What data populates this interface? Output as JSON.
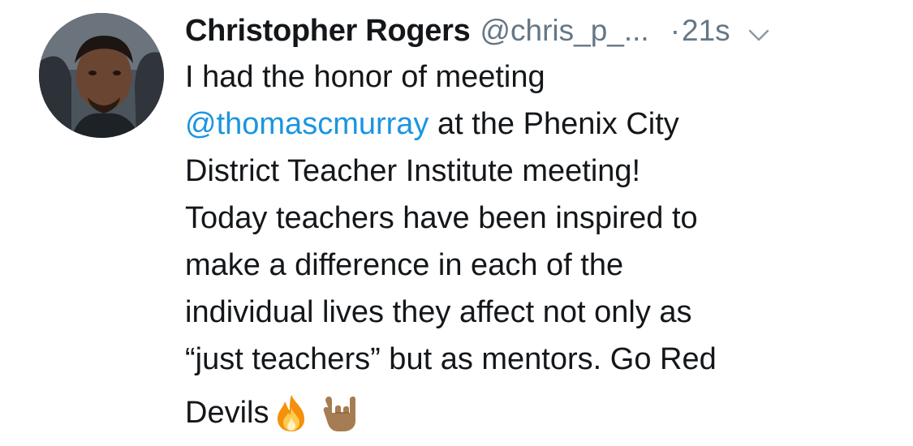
{
  "tweet": {
    "display_name": "Christopher Rogers",
    "handle": "@chris_p_...",
    "separator": "·",
    "timestamp": "21s",
    "menu_icon": "chevron-down-icon",
    "avatar_icon": "avatar",
    "body": {
      "line1": "I had the honor of meeting",
      "mention": "@thomascmurray",
      "line2_rest": " at the Phenix City",
      "line3": "District Teacher Institute meeting!",
      "line4": "Today teachers have been inspired to",
      "line5": "make a difference in each of the",
      "line6": "individual lives they affect not only as",
      "line7": "“just teachers” but as mentors. Go Red",
      "line8": "Devils"
    },
    "emojis": [
      "fire-emoji",
      "sign-of-horns-emoji"
    ],
    "colors": {
      "name": "#14171a",
      "secondary": "#657786",
      "link": "#1b95e0",
      "background": "#ffffff"
    }
  }
}
